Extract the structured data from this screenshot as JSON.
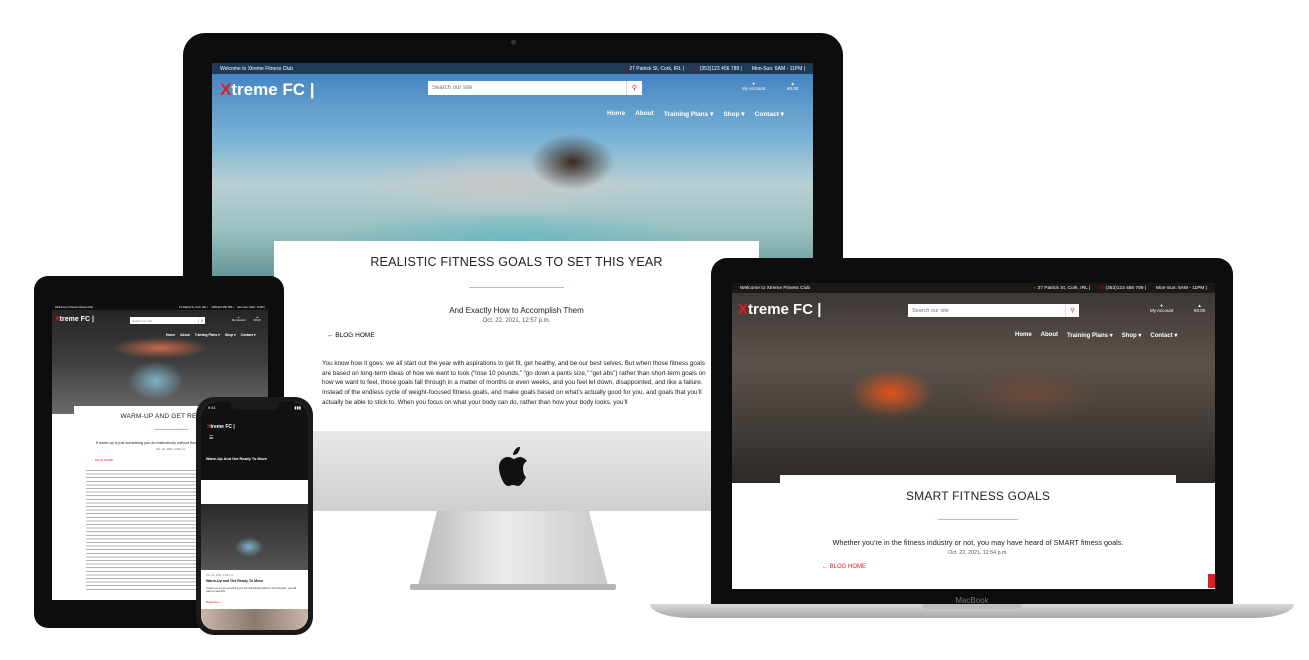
{
  "site": {
    "welcome": "Welcome to Xtreme Fitness Club",
    "address": "27 Patrick St, Cork, IRL |",
    "phone": "(353)123 456 789 |",
    "hours": "Mon-Sun: 6AM - 11PM |",
    "logo_x": "X",
    "logo_rest": "treme FC |",
    "search_placeholder": "Search our site",
    "account_label": "My Account",
    "cart_total": "€0.00",
    "nav": [
      "Home",
      "About",
      "Training Plans ▾",
      "Shop ▾",
      "Contact ▾"
    ],
    "back_link": "← BLOG HOME"
  },
  "imac_post": {
    "title": "REALISTIC FITNESS GOALS TO SET THIS YEAR",
    "subtitle": "And Exactly How to Accomplish Them",
    "date": "Oct. 22, 2021, 12:57 p.m.",
    "body": "You know how it goes: we all start out the year with aspirations to get fit, get healthy, and be our best selves. But when those fitness goals are based on long-term ideas of how we want to look (“lose 10 pounds,” “go down a pants size,” “get abs”) rather than short-term goals on how we want to feel, those goals fall through in a matter of months or even weeks, and you feel let down, disappointed, and like a failure. Instead of the endless cycle of weight-focused fitness goals, and make goals based on what’s actually good for you, and goals that you’ll actually be able to stick to. When you focus on what your body can do, rather than how your body looks, you’ll"
  },
  "macbook_post": {
    "title": "SMART FITNESS GOALS",
    "subtitle": "Whether you’re in the fitness industry or not, you may have heard of SMART fitness goals.",
    "date": "Oct. 22, 2021, 12:54 p.m.",
    "device_label": "MacBook"
  },
  "ipad_post": {
    "title": "WARM-UP AND GET READY TO",
    "subtitle": "If warm-up is just something you do instinctively without thought, you will want to read this",
    "date": "Oct. 22, 2021, 1:09 p.m."
  },
  "phone_post": {
    "time": "9:41",
    "hero_title": "Warm-Up And Get Ready To Move",
    "meta": "Oct. 22, 2021, 1:09 p.m.",
    "card_title": "Warm-Up and Get Ready To Move",
    "card_text": "If warm-up is just something you do instinctively without much thought, you will want to read this.",
    "read_more": "Read More →"
  },
  "colors": {
    "brand_red": "#e51b23",
    "accent_pink": "#f4a6a6",
    "bezel": "#0d0d0d"
  }
}
